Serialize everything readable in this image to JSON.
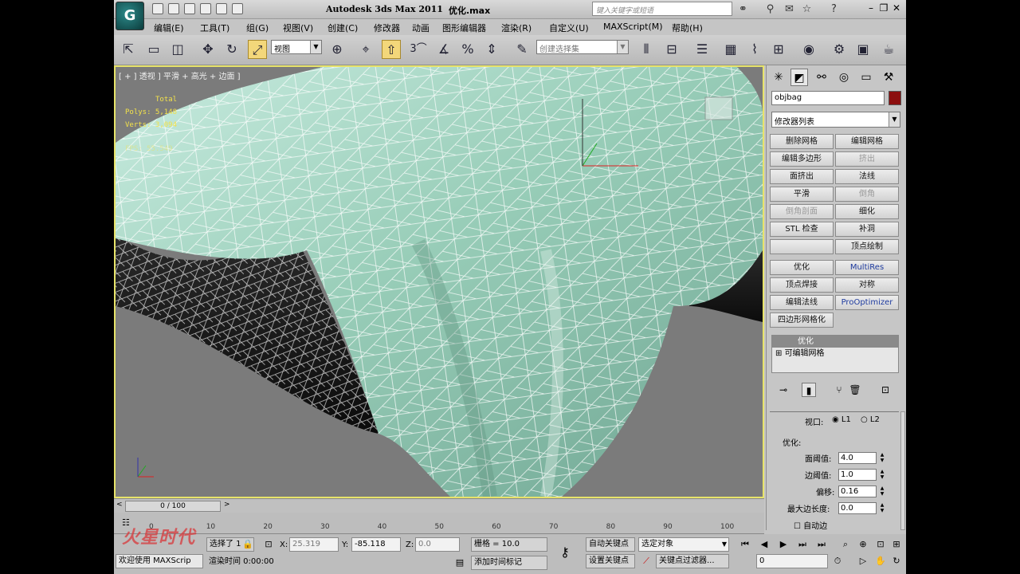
{
  "app": {
    "title": "Autodesk 3ds Max  2011",
    "file": "优化.max",
    "search_placeholder": "键入关键字或短语",
    "logo_text": "G"
  },
  "menu": [
    "编辑(E)",
    "工具(T)",
    "组(G)",
    "视图(V)",
    "创建(C)",
    "修改器",
    "动画",
    "图形编辑器",
    "渲染(R)",
    "自定义(U)",
    "MAXScript(M)",
    "帮助(H)"
  ],
  "toolbar": {
    "ref_coord": "视图",
    "selection_set": "创建选择集",
    "snap_label": "3"
  },
  "viewport": {
    "label": "[ + ] 透视 ] 平滑 + 高光 + 边面 ]",
    "stats": {
      "total_label": "Total",
      "polys": "Polys: 5,148",
      "verts": "Verts: 3,094",
      "fps": "FPS: 55.549"
    },
    "mesh_color": "#a9dbc8",
    "border_color": "#e7e36a"
  },
  "command_panel": {
    "object_name": "objbag",
    "object_color": "#8c0e0e",
    "modifier_list": "修改器列表",
    "buttons": [
      {
        "label": "删除网格",
        "state": "normal"
      },
      {
        "label": "编辑网格",
        "state": "normal"
      },
      {
        "label": "编辑多边形",
        "state": "normal"
      },
      {
        "label": "挤出",
        "state": "disabled"
      },
      {
        "label": "面挤出",
        "state": "normal"
      },
      {
        "label": "法线",
        "state": "normal"
      },
      {
        "label": "平滑",
        "state": "normal"
      },
      {
        "label": "倒角",
        "state": "disabled"
      },
      {
        "label": "倒角剖面",
        "state": "disabled"
      },
      {
        "label": "细化",
        "state": "normal"
      },
      {
        "label": "STL 检查",
        "state": "normal"
      },
      {
        "label": "补洞",
        "state": "normal"
      },
      {
        "label": "",
        "state": "normal"
      },
      {
        "label": "顶点绘制",
        "state": "normal"
      },
      {
        "label": "优化",
        "state": "normal"
      },
      {
        "label": "MultiRes",
        "state": "blue"
      },
      {
        "label": "顶点焊接",
        "state": "normal"
      },
      {
        "label": "对称",
        "state": "normal"
      },
      {
        "label": "编辑法线",
        "state": "normal"
      },
      {
        "label": "ProOptimizer",
        "state": "blue"
      },
      {
        "label": "四边形网格化",
        "state": "normal"
      }
    ],
    "stack": {
      "top": "优化",
      "base": "可编辑网格"
    },
    "rollout": {
      "viewport_label": "视口:",
      "l1": "L1",
      "l2": "L2",
      "group": "优化:",
      "face_thresh_label": "面阈值:",
      "face_thresh": "4.0",
      "edge_thresh_label": "边阈值:",
      "edge_thresh": "1.0",
      "bias_label": "偏移:",
      "bias": "0.16",
      "max_edge_label": "最大边长度:",
      "max_edge": "0.0",
      "auto_edge": "自动边"
    }
  },
  "timeline": {
    "slider": "0 / 100",
    "ticks": [
      "0",
      "10",
      "20",
      "30",
      "40",
      "50",
      "60",
      "70",
      "80",
      "90",
      "100"
    ]
  },
  "status": {
    "selected": "选择了 1",
    "x_label": "X:",
    "x": "25.319",
    "y_label": "Y:",
    "y": "-85.118",
    "z_label": "Z:",
    "z": "0.0",
    "grid": "栅格 = 10.0",
    "auto_key": "自动关键点",
    "selected_obj": "选定对象",
    "set_key": "设置关键点",
    "key_filter": "关键点过滤器...",
    "welcome": "欢迎使用  MAXScrip",
    "render_time": "渲染时间 0:00:00",
    "add_time_tag": "添加时间标记",
    "frame": "0"
  },
  "watermark": "火星时代"
}
